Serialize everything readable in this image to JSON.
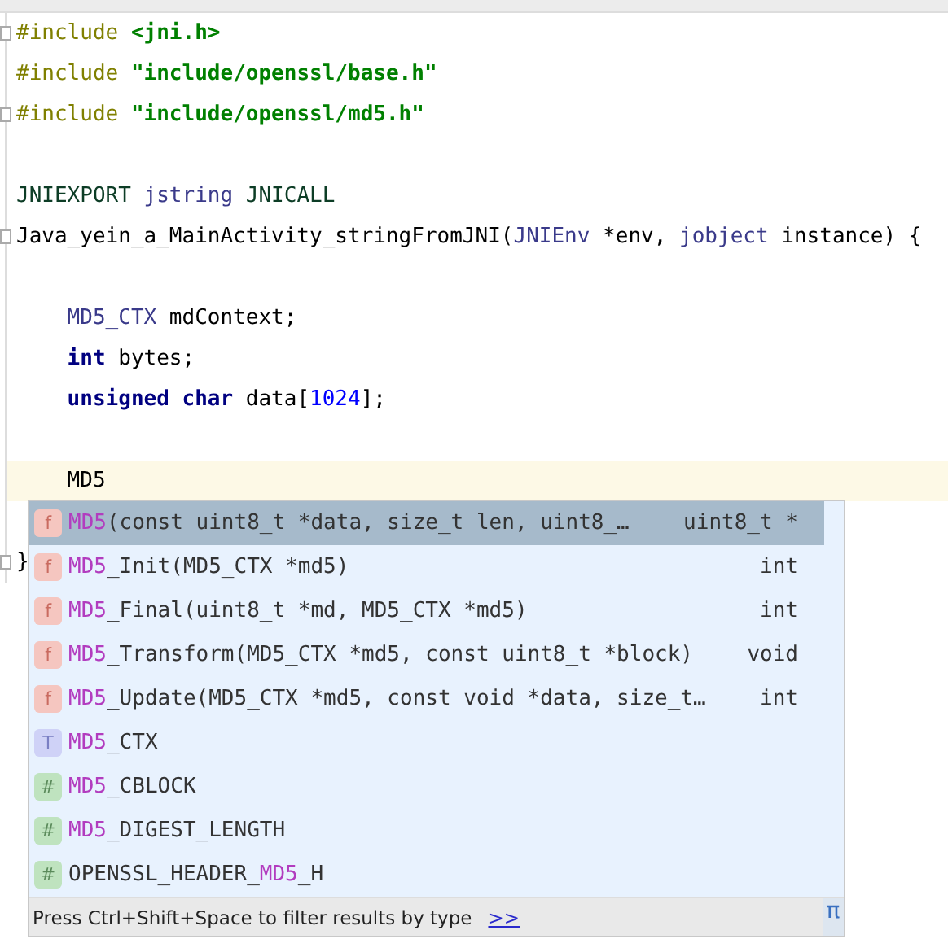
{
  "editor": {
    "blocks": [
      {
        "lines": [
          {
            "fold": true,
            "current": false,
            "tokens": [
              {
                "kind": "preprocessor",
                "text": "#include"
              },
              {
                "kind": "string",
                "text": " <jni.h>"
              }
            ]
          },
          {
            "fold": false,
            "current": false,
            "tokens": [
              {
                "kind": "preprocessor",
                "text": "#include"
              },
              {
                "kind": "string",
                "text": " \"include/openssl/base.h\""
              }
            ]
          },
          {
            "fold": true,
            "current": false,
            "tokens": [
              {
                "kind": "preprocessor",
                "text": "#include"
              },
              {
                "kind": "string",
                "text": " \"include/openssl/md5.h\""
              }
            ]
          }
        ]
      },
      {
        "lines": [
          {
            "fold": false,
            "current": false,
            "tokens": [
              {
                "kind": "macro",
                "text": "JNIEXPORT"
              },
              {
                "kind": "type",
                "text": " jstring"
              },
              {
                "kind": "macro",
                "text": " JNICALL"
              }
            ]
          },
          {
            "fold": true,
            "current": false,
            "tokens": [
              {
                "kind": "plain",
                "text": "Java_yein_a_MainActivity_stringFromJNI("
              },
              {
                "kind": "type",
                "text": "JNIEnv"
              },
              {
                "kind": "plain",
                "text": " *env, "
              },
              {
                "kind": "type",
                "text": "jobject"
              },
              {
                "kind": "plain",
                "text": " instance) {"
              }
            ]
          }
        ]
      },
      {
        "lines": [
          {
            "fold": false,
            "current": false,
            "tokens": [
              {
                "kind": "type",
                "text": "    MD5_CTX"
              },
              {
                "kind": "plain",
                "text": " mdContext;"
              }
            ]
          },
          {
            "fold": false,
            "current": false,
            "tokens": [
              {
                "kind": "keyword",
                "text": "    int"
              },
              {
                "kind": "plain",
                "text": " bytes;"
              }
            ]
          },
          {
            "fold": false,
            "current": false,
            "tokens": [
              {
                "kind": "keyword",
                "text": "    unsigned"
              },
              {
                "kind": "keyword",
                "text": " char"
              },
              {
                "kind": "plain",
                "text": " data["
              },
              {
                "kind": "number",
                "text": "1024"
              },
              {
                "kind": "plain",
                "text": "];"
              }
            ]
          }
        ]
      },
      {
        "lines": [
          {
            "fold": false,
            "current": true,
            "tokens": [
              {
                "kind": "plain",
                "text": "    MD5"
              }
            ]
          }
        ]
      },
      {
        "lines": [
          {
            "fold": true,
            "current": false,
            "tokens": [
              {
                "kind": "plain",
                "text": "}"
              }
            ]
          }
        ]
      }
    ]
  },
  "completion": {
    "items": [
      {
        "kind": "function",
        "badge": "f",
        "match": "MD5",
        "after": "(const uint8_t *data, size_t len, uint8_…",
        "type": "uint8_t *",
        "selected": true
      },
      {
        "kind": "function",
        "badge": "f",
        "match": "MD5",
        "after": "_Init(MD5_CTX *md5)",
        "type": "int",
        "selected": false
      },
      {
        "kind": "function",
        "badge": "f",
        "match": "MD5",
        "after": "_Final(uint8_t *md, MD5_CTX *md5)",
        "type": "int",
        "selected": false
      },
      {
        "kind": "function",
        "badge": "f",
        "match": "MD5",
        "after": "_Transform(MD5_CTX *md5, const uint8_t *block)",
        "type": "void",
        "selected": false
      },
      {
        "kind": "function",
        "badge": "f",
        "match": "MD5",
        "after": "_Update(MD5_CTX *md5, const void *data, size_t…",
        "type": "int",
        "selected": false
      },
      {
        "kind": "type",
        "badge": "T",
        "match": "MD5",
        "after": "_CTX",
        "selected": false
      },
      {
        "kind": "macro",
        "badge": "#",
        "match": "MD5",
        "after": "_CBLOCK",
        "selected": false
      },
      {
        "kind": "macro",
        "badge": "#",
        "match": "MD5",
        "after": "_DIGEST_LENGTH",
        "selected": false
      },
      {
        "kind": "macro",
        "badge": "#",
        "before": "OPENSSL_HEADER_",
        "match": "MD5",
        "after": "_H",
        "selected": false
      }
    ],
    "hint": "Press Ctrl+Shift+Space to filter results by type",
    "hint_link": ">>",
    "pi": "π"
  }
}
